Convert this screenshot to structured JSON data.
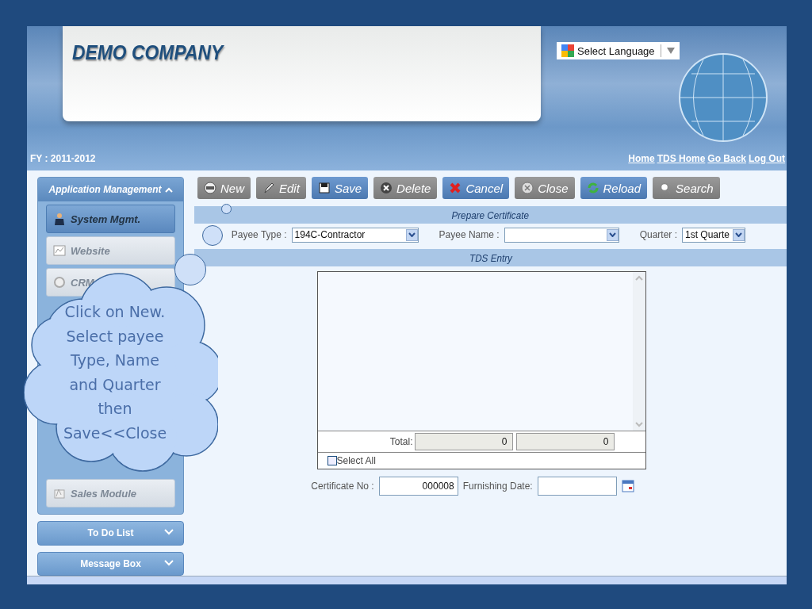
{
  "header": {
    "company": "DEMO COMPANY",
    "language_select": "Select Language",
    "fiscal_year": "FY : 2011-2012",
    "links": [
      "Home",
      "TDS Home",
      "Go Back",
      "Log Out"
    ]
  },
  "sidebar": {
    "section": "Application Management",
    "items": [
      {
        "label": "System Mgmt.",
        "kind": "person",
        "selected": true,
        "disabled": false
      },
      {
        "label": "Website",
        "kind": "web",
        "selected": false,
        "disabled": true
      },
      {
        "label": "CRM",
        "kind": "crm",
        "selected": false,
        "disabled": true
      },
      {
        "label": "Sales Module",
        "kind": "sales",
        "selected": false,
        "disabled": true
      }
    ],
    "panels": [
      {
        "label": "To Do List"
      },
      {
        "label": "Message Box"
      }
    ]
  },
  "toolbar": [
    {
      "label": "New",
      "kind": "new",
      "highlighted": false
    },
    {
      "label": "Edit",
      "kind": "edit",
      "highlighted": false
    },
    {
      "label": "Save",
      "kind": "save",
      "highlighted": true
    },
    {
      "label": "Delete",
      "kind": "delete",
      "highlighted": false
    },
    {
      "label": "Cancel",
      "kind": "cancel",
      "highlighted": true
    },
    {
      "label": "Close",
      "kind": "close",
      "highlighted": false
    },
    {
      "label": "Reload",
      "kind": "reload",
      "highlighted": true
    },
    {
      "label": "Search",
      "kind": "search",
      "highlighted": false
    }
  ],
  "form": {
    "title": "Prepare Certificate",
    "payee_type": {
      "label": "Payee Type :",
      "value": "194C-Contractor"
    },
    "payee_name": {
      "label": "Payee Name :"
    },
    "quarter": {
      "label": "Quarter :",
      "value": "1st Quarte"
    },
    "section": "TDS Entry",
    "total_label": "Total:",
    "totals": [
      "0",
      "0"
    ],
    "select_all": {
      "label": "Select All",
      "checked": false
    },
    "certificate_no": {
      "label": "Certificate No :",
      "value": "000008"
    },
    "furnishing_date": {
      "label": "Furnishing Date:"
    }
  },
  "callout": {
    "text": "Click on New. Select payee Type, Name and Quarter then Save<<Close"
  }
}
